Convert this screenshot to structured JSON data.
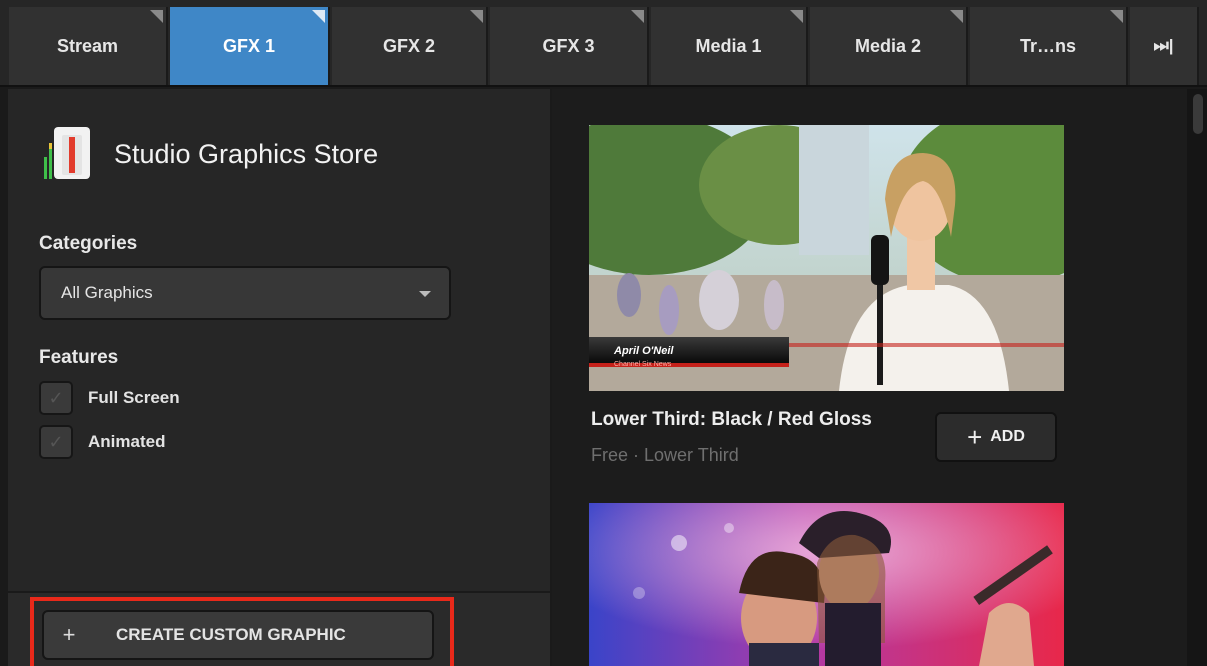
{
  "tabs": [
    {
      "label": "Stream",
      "active": false
    },
    {
      "label": "GFX 1",
      "active": true
    },
    {
      "label": "GFX 2",
      "active": false
    },
    {
      "label": "GFX 3",
      "active": false
    },
    {
      "label": "Media 1",
      "active": false
    },
    {
      "label": "Media 2",
      "active": false
    },
    {
      "label": "Tr…ns",
      "active": false
    }
  ],
  "tabbar": {
    "overflow_icon": "skip-forward-icon",
    "overflow_glyph": "⏭|"
  },
  "store": {
    "title": "Studio Graphics Store",
    "icon": "graphics-store-icon"
  },
  "filters": {
    "categories_label": "Categories",
    "category_selected": "All Graphics",
    "features_label": "Features",
    "features": [
      {
        "label": "Full Screen",
        "checked": false
      },
      {
        "label": "Animated",
        "checked": false
      }
    ]
  },
  "footer": {
    "create_plus": "+",
    "create_label": "CREATE CUSTOM GRAPHIC"
  },
  "cards": [
    {
      "title": "Lower Third: Black / Red Gloss",
      "subtitle": "Free · Lower Third",
      "add_plus": "+",
      "add_label": "ADD",
      "preview_name": "April O'Neil",
      "preview_sub": "Channel Six News"
    }
  ],
  "colors": {
    "accent": "#3f87c7",
    "highlight": "#e8291a",
    "background": "#1a1a1a"
  }
}
